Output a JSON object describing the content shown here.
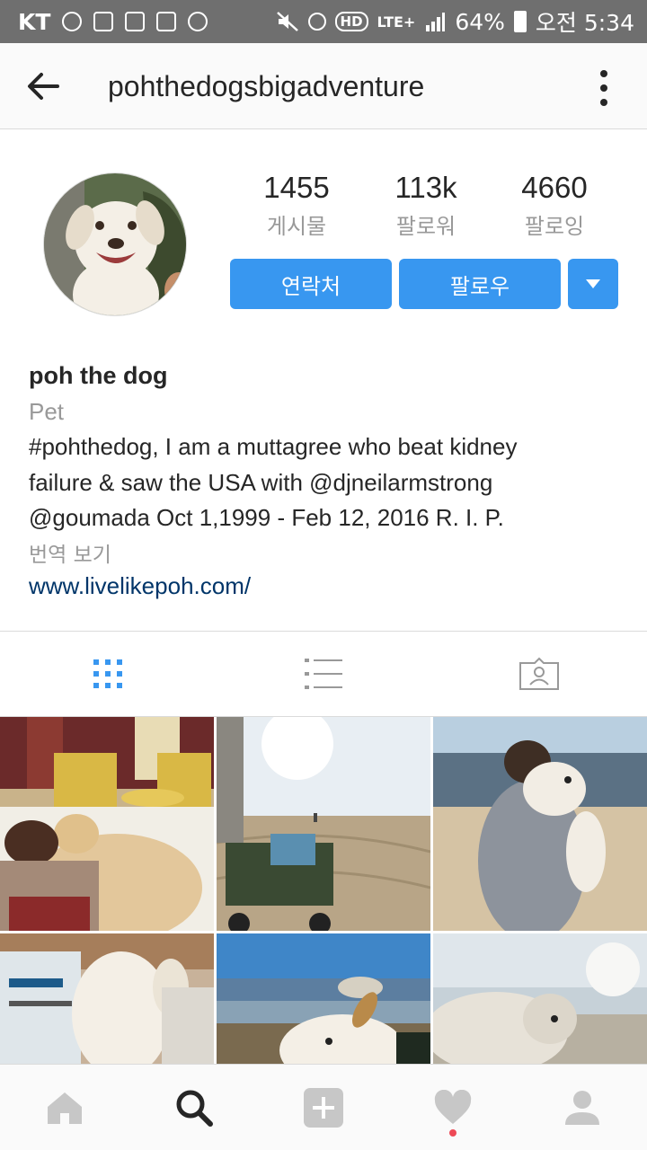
{
  "status_bar": {
    "carrier": "KT",
    "hd": "HD",
    "network": "LTE+",
    "battery": "64%",
    "time": "오전 5:34"
  },
  "header": {
    "username": "pohthedogsbigadventure",
    "icons": {
      "back": "arrow-left",
      "more": "vertical-dots"
    }
  },
  "stats": [
    {
      "value": "1455",
      "label": "게시물"
    },
    {
      "value": "113k",
      "label": "팔로워"
    },
    {
      "value": "4660",
      "label": "팔로잉"
    }
  ],
  "actions": {
    "contact_label": "연락처",
    "follow_label": "팔로우",
    "accent_color": "#3897f0"
  },
  "bio": {
    "name": "poh the dog",
    "category": "Pet",
    "lines": [
      "#pohthedog, I am a muttagree who beat kidney",
      "failure & saw the USA with @djneilarmstrong",
      "@goumada Oct 1,1999 - Feb 12, 2016 R. I. P."
    ],
    "translate_label": "번역 보기",
    "website": "www.livelikepoh.com/"
  },
  "view_tabs": [
    {
      "icon": "grid-icon",
      "active": true
    },
    {
      "icon": "list-icon",
      "active": false
    },
    {
      "icon": "tagged-person-icon",
      "active": false
    }
  ],
  "bottom_nav": [
    {
      "icon": "home-icon"
    },
    {
      "icon": "search-icon",
      "active": true
    },
    {
      "icon": "add-post-icon"
    },
    {
      "icon": "heart-icon",
      "has_notification": true
    },
    {
      "icon": "profile-icon"
    }
  ]
}
